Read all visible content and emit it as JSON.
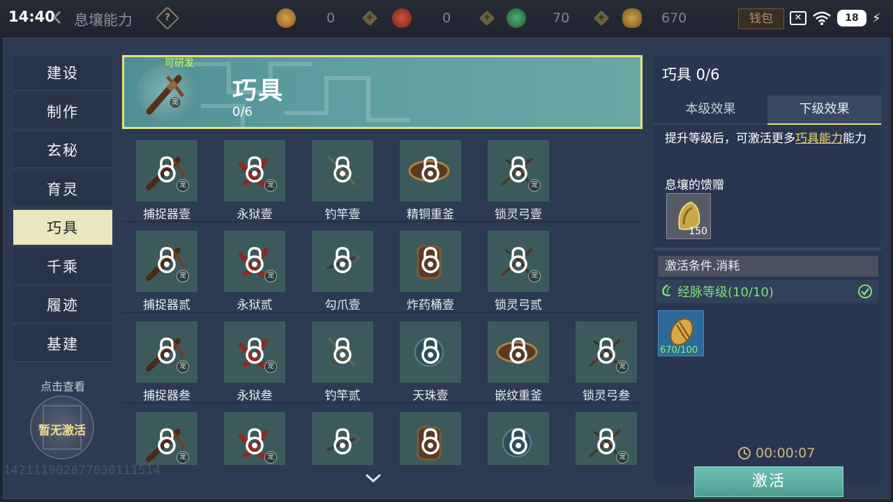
{
  "status_bar": {
    "time": "14:40",
    "battery": "18"
  },
  "header": {
    "title": "息壤能力",
    "resources": [
      {
        "name": "resource-1",
        "value": "0",
        "color": "#b07430"
      },
      {
        "name": "resource-2",
        "value": "0",
        "color": "#a03828"
      },
      {
        "name": "resource-3",
        "value": "70",
        "color": "#2f7a48"
      },
      {
        "name": "resource-4",
        "value": "670",
        "color": "#a07a30"
      }
    ],
    "wallet_label": "钱包"
  },
  "sidebar": {
    "items": [
      {
        "label": "建设"
      },
      {
        "label": "制作"
      },
      {
        "label": "玄秘"
      },
      {
        "label": "育灵"
      },
      {
        "label": "巧具",
        "active": true
      },
      {
        "label": "千乘"
      },
      {
        "label": "履迹"
      },
      {
        "label": "基建"
      }
    ],
    "click_view": "点击查看",
    "seal_text": "暂无激活",
    "watermark": "142111902877030111514"
  },
  "banner": {
    "tag": "可研发",
    "pet_mark": "宠",
    "title": "巧具",
    "count": "0/6"
  },
  "grid": {
    "rows": [
      [
        {
          "label": "捕捉器壹",
          "kind": "crossbow"
        },
        {
          "label": "永狱壹",
          "kind": "red"
        },
        {
          "label": "钓竿壹",
          "kind": "rod"
        },
        {
          "label": "精铜重釜",
          "kind": "bronze"
        },
        {
          "label": "锁灵弓壹",
          "kind": "bow"
        }
      ],
      [
        {
          "label": "捕捉器贰",
          "kind": "crossbow"
        },
        {
          "label": "永狱贰",
          "kind": "red"
        },
        {
          "label": "勾爪壹",
          "kind": "claw"
        },
        {
          "label": "炸药桶壹",
          "kind": "barrel"
        },
        {
          "label": "锁灵弓贰",
          "kind": "bow"
        }
      ],
      [
        {
          "label": "捕捉器叁",
          "kind": "crossbow"
        },
        {
          "label": "永狱叁",
          "kind": "red"
        },
        {
          "label": "钓竿贰",
          "kind": "rod"
        },
        {
          "label": "天珠壹",
          "kind": "pearl"
        },
        {
          "label": "嵌纹重釜",
          "kind": "bronze"
        },
        {
          "label": "锁灵弓叁",
          "kind": "bow"
        }
      ],
      [
        {
          "label": "",
          "kind": "crossbow"
        },
        {
          "label": "",
          "kind": "red"
        },
        {
          "label": "",
          "kind": "claw"
        },
        {
          "label": "",
          "kind": "barrel"
        },
        {
          "label": "",
          "kind": "pearl"
        },
        {
          "label": "",
          "kind": "bow"
        }
      ]
    ],
    "pet_mark": "宠"
  },
  "detail": {
    "title": "巧具 0/6",
    "tabs": [
      {
        "label": "本级效果"
      },
      {
        "label": "下级效果",
        "active": true
      }
    ],
    "effect_prefix": "提升等级后，可激活更多",
    "effect_highlight": "巧具能力",
    "effect_suffix": "能力",
    "gift_label": "息壤的馈赠",
    "gift_qty": "150",
    "cond_header": "激活条件.消耗",
    "cond_text": "经脉等级(10/10)",
    "cost_qty": "670/100",
    "timer": "00:00:07",
    "activate_label": "激活"
  }
}
